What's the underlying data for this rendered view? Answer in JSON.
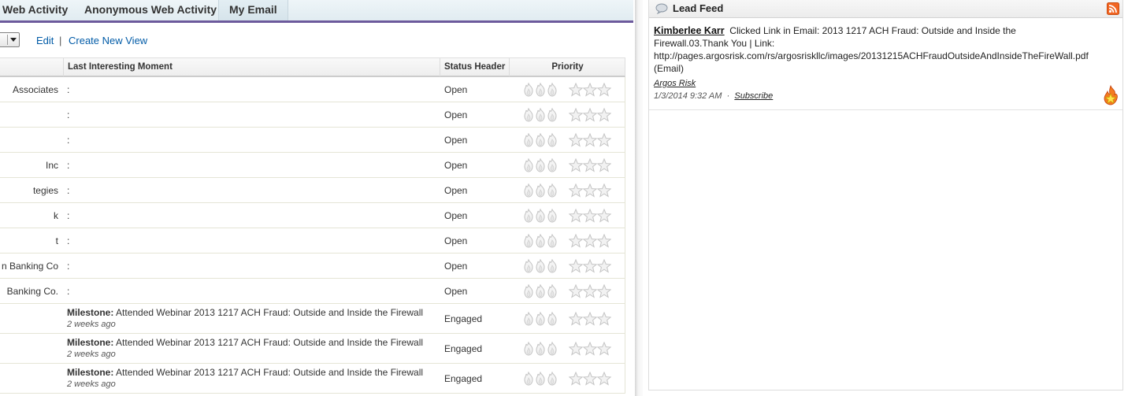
{
  "tabs": [
    "Web Activity",
    "Anonymous Web Activity",
    "My Email"
  ],
  "view_bar": {
    "edit": "Edit",
    "sep": "|",
    "create": "Create New View"
  },
  "columns": {
    "moment": "Last Interesting Moment",
    "status": "Status Header",
    "priority": "Priority"
  },
  "rows": [
    {
      "name": "Associates",
      "moment": ":",
      "status": "Open"
    },
    {
      "name": "",
      "moment": ":",
      "status": "Open"
    },
    {
      "name": "",
      "moment": ":",
      "status": "Open"
    },
    {
      "name": "Inc",
      "moment": ":",
      "status": "Open"
    },
    {
      "name": "tegies",
      "moment": ":",
      "status": "Open"
    },
    {
      "name": "k",
      "moment": ":",
      "status": "Open"
    },
    {
      "name": "t",
      "moment": ":",
      "status": "Open"
    },
    {
      "name": "n Banking Co",
      "moment": ":",
      "status": "Open"
    },
    {
      "name": "Banking Co.",
      "moment": ":",
      "status": "Open"
    },
    {
      "milestone_label": "Milestone:",
      "milestone_text": " Attended Webinar 2013 1217 ACH Fraud: Outside and Inside the Firewall",
      "ago": "2 weeks ago",
      "status": "Engaged"
    },
    {
      "milestone_label": "Milestone:",
      "milestone_text": " Attended Webinar 2013 1217 ACH Fraud: Outside and Inside the Firewall",
      "ago": "2 weeks ago",
      "status": "Engaged"
    },
    {
      "milestone_label": "Milestone:",
      "milestone_text": " Attended Webinar 2013 1217 ACH Fraud: Outside and Inside the Firewall",
      "ago": "2 weeks ago",
      "status": "Engaged"
    }
  ],
  "feed": {
    "title": "Lead Feed",
    "item": {
      "author": "Kimberlee Karr",
      "line1": "Clicked Link in Email: 2013 1217 ACH Fraud: Outside and Inside the",
      "line2": "Firewall.03.Thank You | Link:",
      "line3": "http://pages.argosrisk.com/rs/argosriskllc/images/20131215ACHFraudOutsideAndInsideTheFireWall.pdf",
      "line4": "(Email)",
      "source": "Argos Risk",
      "timestamp": "1/3/2014 9:32 AM",
      "dot": "·",
      "subscribe": "Subscribe"
    }
  },
  "colors": {
    "accent": "#6c5a9c",
    "link": "#015ba7",
    "rss": "#f26522"
  },
  "icons": {
    "flame": "flame-icon",
    "star": "star-icon",
    "bubble": "chat-bubble-icon",
    "rss": "rss-icon",
    "hot": "hot-star-icon"
  }
}
